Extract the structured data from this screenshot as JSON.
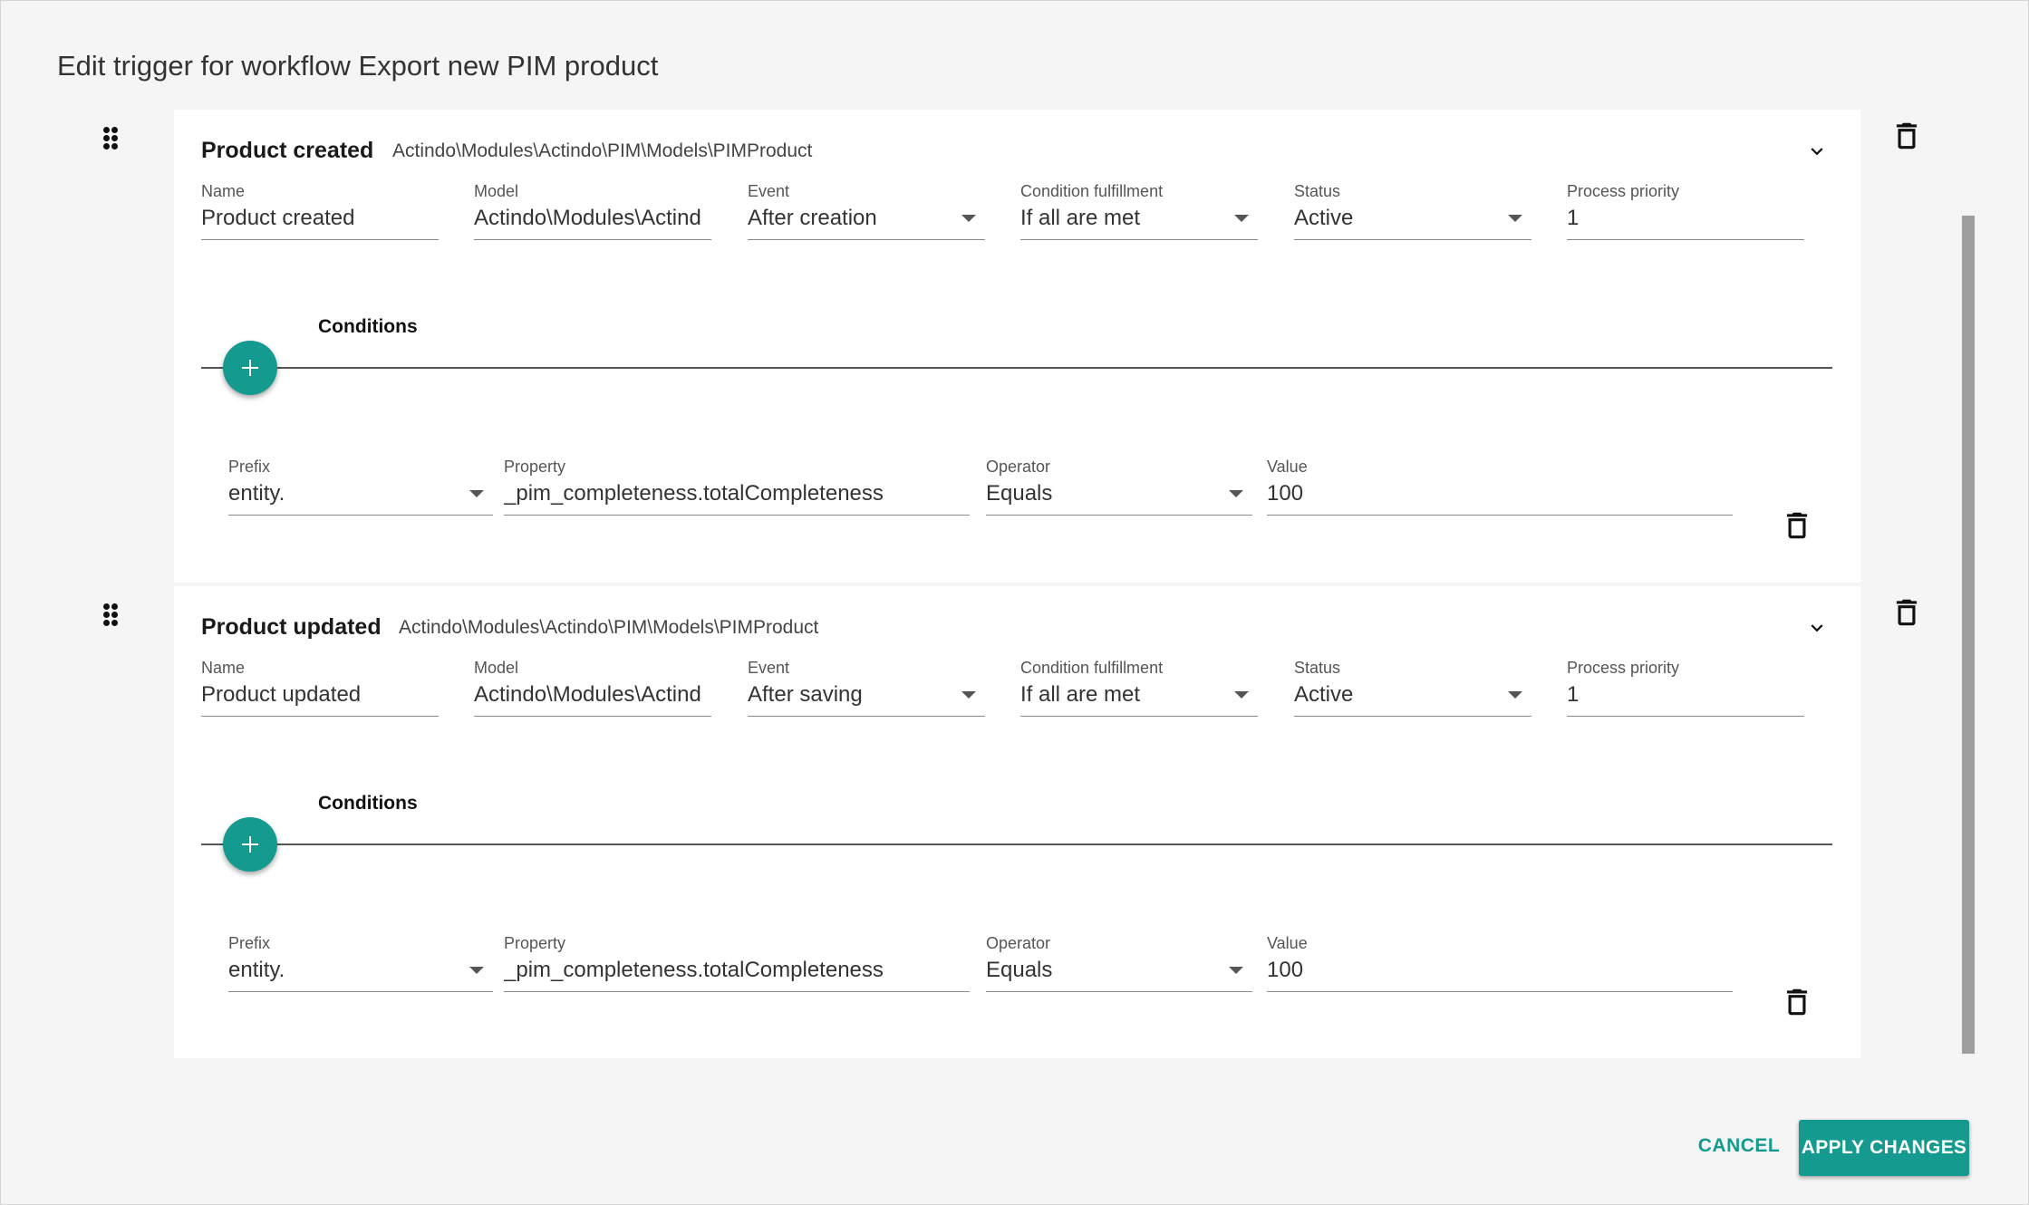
{
  "dialog": {
    "title": "Edit trigger for workflow Export new PIM product"
  },
  "triggers": [
    {
      "heading": "Product created",
      "model_path": "Actindo\\Modules\\Actindo\\PIM\\Models\\PIMProduct",
      "fields": {
        "name": {
          "label": "Name",
          "value": "Product created"
        },
        "model": {
          "label": "Model",
          "value": "Actindo\\Modules\\Actind"
        },
        "event": {
          "label": "Event",
          "value": "After creation"
        },
        "condition_fulfillment": {
          "label": "Condition fulfillment",
          "value": "If all are met"
        },
        "status": {
          "label": "Status",
          "value": "Active"
        },
        "process_priority": {
          "label": "Process priority",
          "value": "1"
        }
      },
      "conditions_label": "Conditions",
      "condition": {
        "prefix": {
          "label": "Prefix",
          "value": "entity."
        },
        "property": {
          "label": "Property",
          "value": "_pim_completeness.totalCompleteness"
        },
        "operator": {
          "label": "Operator",
          "value": "Equals"
        },
        "value": {
          "label": "Value",
          "value": "100"
        }
      }
    },
    {
      "heading": "Product updated",
      "model_path": "Actindo\\Modules\\Actindo\\PIM\\Models\\PIMProduct",
      "fields": {
        "name": {
          "label": "Name",
          "value": "Product updated"
        },
        "model": {
          "label": "Model",
          "value": "Actindo\\Modules\\Actind"
        },
        "event": {
          "label": "Event",
          "value": "After saving"
        },
        "condition_fulfillment": {
          "label": "Condition fulfillment",
          "value": "If all are met"
        },
        "status": {
          "label": "Status",
          "value": "Active"
        },
        "process_priority": {
          "label": "Process priority",
          "value": "1"
        }
      },
      "conditions_label": "Conditions",
      "condition": {
        "prefix": {
          "label": "Prefix",
          "value": "entity."
        },
        "property": {
          "label": "Property",
          "value": "_pim_completeness.totalCompleteness"
        },
        "operator": {
          "label": "Operator",
          "value": "Equals"
        },
        "value": {
          "label": "Value",
          "value": "100"
        }
      }
    }
  ],
  "actions": {
    "cancel": "CANCEL",
    "apply": "APPLY CHANGES"
  },
  "colors": {
    "accent": "#159a8f"
  },
  "icons": [
    "drag-handle-icon",
    "trash-icon",
    "chevron-down-icon",
    "plus-icon",
    "dropdown-arrow-icon"
  ]
}
